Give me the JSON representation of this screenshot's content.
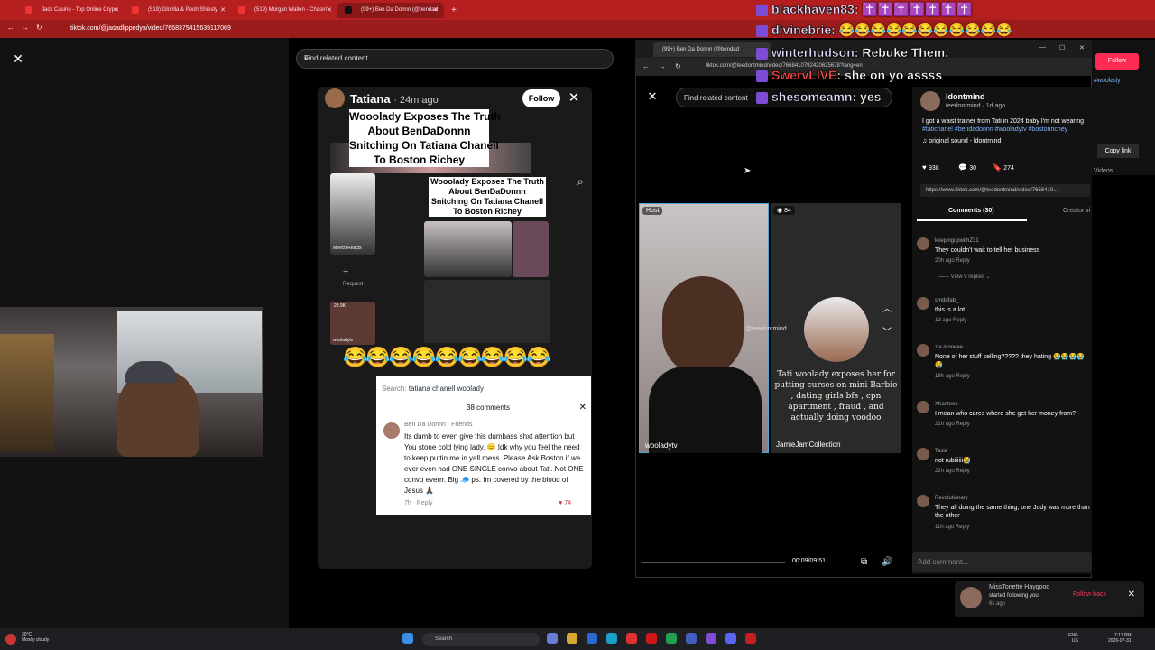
{
  "browser": {
    "tabs": [
      "Jack Casino - Top Online Crypt",
      "(519) Glorilla & Pooh Shiesty",
      "(519) Morgan Wallen - Chasin'",
      "(99+) Ben Da Donnn (@bendad"
    ],
    "url": "tiktok.com/@jadadlippedya/video/7668375415639117069"
  },
  "center": {
    "search_placeholder": "Find related content",
    "user": "Tatiana",
    "time": "24m ago",
    "follow_label": "Follow",
    "caption_lines": [
      "Wooolady Exposes The Truth",
      "About BenDaDonnn",
      "Snitching On Tatiana Chanell",
      "To Boston Richey"
    ],
    "emoji_row": "😂😂😂😂😂😂😂😂😂",
    "comment_box": {
      "search_label": "Search:",
      "search_query": "tatiana chanell woolady",
      "comments_count": "38 comments",
      "author": "Ben Da Donnn",
      "author_tag": "· Friends",
      "text": "Its dumb to even give this dumbass shxt attention but You stone cold lying lady. 😑 Idk why you feel the need to keep puttin me in yall mess. Please Ask Boston if we ever even had ONE SINGLE convo about Tati. Not ONE convo everrr. Big 🧢 ps. Im covered by the blood of Jesus 🙏🏿",
      "time": "7h",
      "reply": "Reply",
      "likes": "74"
    },
    "inner": {
      "caption_lines": [
        "Wooolady Exposes The Truth",
        "About BenDaDonnn",
        "Snitching On Tatiana Chanell",
        "To Boston Richey"
      ],
      "labels": [
        "MeechiReacts",
        "Request",
        "23.9K",
        "wooladytv"
      ]
    }
  },
  "popup": {
    "tab_title": "(99+) Ben Da Donnn (@bendad",
    "url": "tiktok.com/@teedontmind/video/7668410792420625678?lang=en",
    "search_placeholder": "Find related content",
    "host_badge": "Host",
    "viewer_badge": "84",
    "left_name": "wooladytv",
    "right_name": "JamieJamCollection",
    "right_handle": "@teedontmind",
    "right_caption": "Tati woolady exposes her for putting curses on mini Barbie , dating girls bfs , cpn apartment , fraud , and actually doing voodoo",
    "time": "00:09/09:51",
    "author": "ldontmind",
    "handle": "teedontmind · 1d ago",
    "desc": "I got a waist trainer from Tati in 2024 baby I'm not wearing",
    "tags": "#tatichanel #bendadonnn #wooladytv #bostonrichey",
    "sound": "original sound - ldontmind",
    "likes": "938",
    "comments": "30",
    "saves": "274",
    "link": "https://www.tiktok.com/@teedontmind/video/7668410...",
    "tab_comments": "Comments (30)",
    "tab_creator": "Creator vi",
    "comments_list": [
      {
        "name": "keepingupwithZ31",
        "text": "They couldn't wait to tell her business",
        "meta": "20h ago   Reply"
      },
      {
        "name": "smdufab_",
        "text": "this is a lot",
        "meta": "1d ago   Reply"
      },
      {
        "name": "zia moneee",
        "text": "None of her stuff selling????? they hating 😭😭😭😭😭",
        "meta": "18h ago   Reply"
      },
      {
        "name": "Xhanteee",
        "text": "I mean who cares where she get her money from?",
        "meta": "21h ago   Reply"
      },
      {
        "name": "Tasia",
        "text": "not rubiiiiii😭",
        "meta": "22h ago   Reply"
      },
      {
        "name": "Revolutionary",
        "text": "They all doing the same thing, one Judy was more than the other",
        "meta": "11h ago   Reply"
      }
    ],
    "view_replies": "View 9 replies",
    "add_comment": "Add comment..."
  },
  "chat": [
    {
      "user": "blackhaven83",
      "msg": "✝️✝️✝️✝️✝️✝️✝️"
    },
    {
      "user": "divinebrie",
      "msg": "😂😂😂😂😂😂😂😂😂😂😂"
    },
    {
      "user": "winterhudson",
      "msg": "Rebuke Them."
    },
    {
      "user": "SwervLIVE",
      "msg": "she on yo assss"
    },
    {
      "user": "shesomeamn",
      "msg": "yes"
    }
  ],
  "right_strip": {
    "follow": "Follow",
    "tag": "#woolady",
    "copy_link": "Copy link",
    "videos": "Videos"
  },
  "notification": {
    "name": "MissTonette Haygood",
    "action": "started following you.",
    "time": "6s ago",
    "follow_back": "Follow back"
  },
  "taskbar": {
    "weather_temp": "30°C",
    "weather_desc": "Mostly cloudy",
    "search": "Search",
    "lang": "ENG",
    "region": "US",
    "time": "7:17 PM",
    "date": "2026-07-31"
  }
}
